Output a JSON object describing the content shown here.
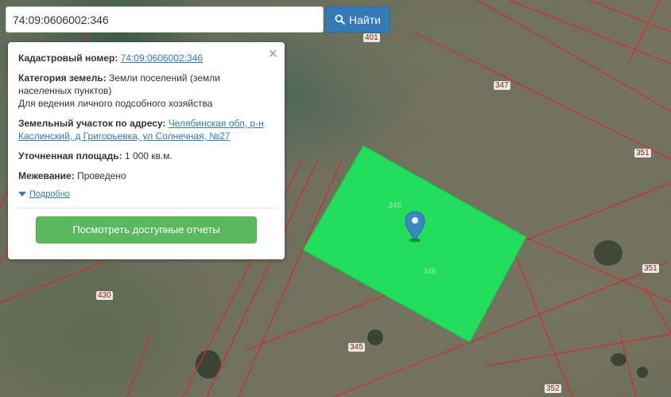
{
  "search": {
    "value": "74:09:0606002:346",
    "button_label": "Найти"
  },
  "panel": {
    "cadastral_label": "Кадастровый номер:",
    "cadastral_value": "74:09:0606002:346",
    "category_label": "Категория земель:",
    "category_value": "Земли поселений (земли населенных пунктов)",
    "usage": "Для ведения личного подсобного хозяйства",
    "address_label": "Земельный участок по адресу:",
    "address_value": "Челябинская обл, р-н Каслинский, д Григорьевка, ул Солнечная, №27",
    "area_label": "Уточненная площадь:",
    "area_value": "1 000 кв.м.",
    "survey_label": "Межевание:",
    "survey_value": "Проведено",
    "details_label": "Подробно",
    "reports_button": "Посмотреть доступные отчеты"
  },
  "map": {
    "parcel_labels": [
      "401",
      "347",
      "351",
      "346",
      "346",
      "351",
      "430",
      "345",
      "352"
    ],
    "highlight_color": "#1fe25b",
    "boundary_color": "#d42a2a",
    "marker_color": "#3a87c8"
  }
}
